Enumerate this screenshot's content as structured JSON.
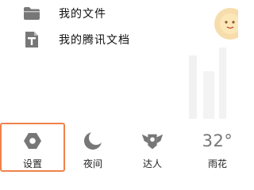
{
  "menu": {
    "items": [
      {
        "label": "我的文件",
        "icon": "folder-icon"
      },
      {
        "label": "我的腾讯文档",
        "icon": "tencent-docs-icon"
      }
    ]
  },
  "bottom_bar": {
    "settings": {
      "label": "设置",
      "icon": "settings-icon"
    },
    "night": {
      "label": "夜间",
      "icon": "moon-icon"
    },
    "talent": {
      "label": "达人",
      "icon": "talent-badge-icon"
    },
    "weather": {
      "temperature": "32°",
      "label": "雨花",
      "icon": "weather-icon"
    }
  },
  "colors": {
    "highlight_border": "#f0824a",
    "icon_gray": "#777777",
    "text": "#111111"
  }
}
